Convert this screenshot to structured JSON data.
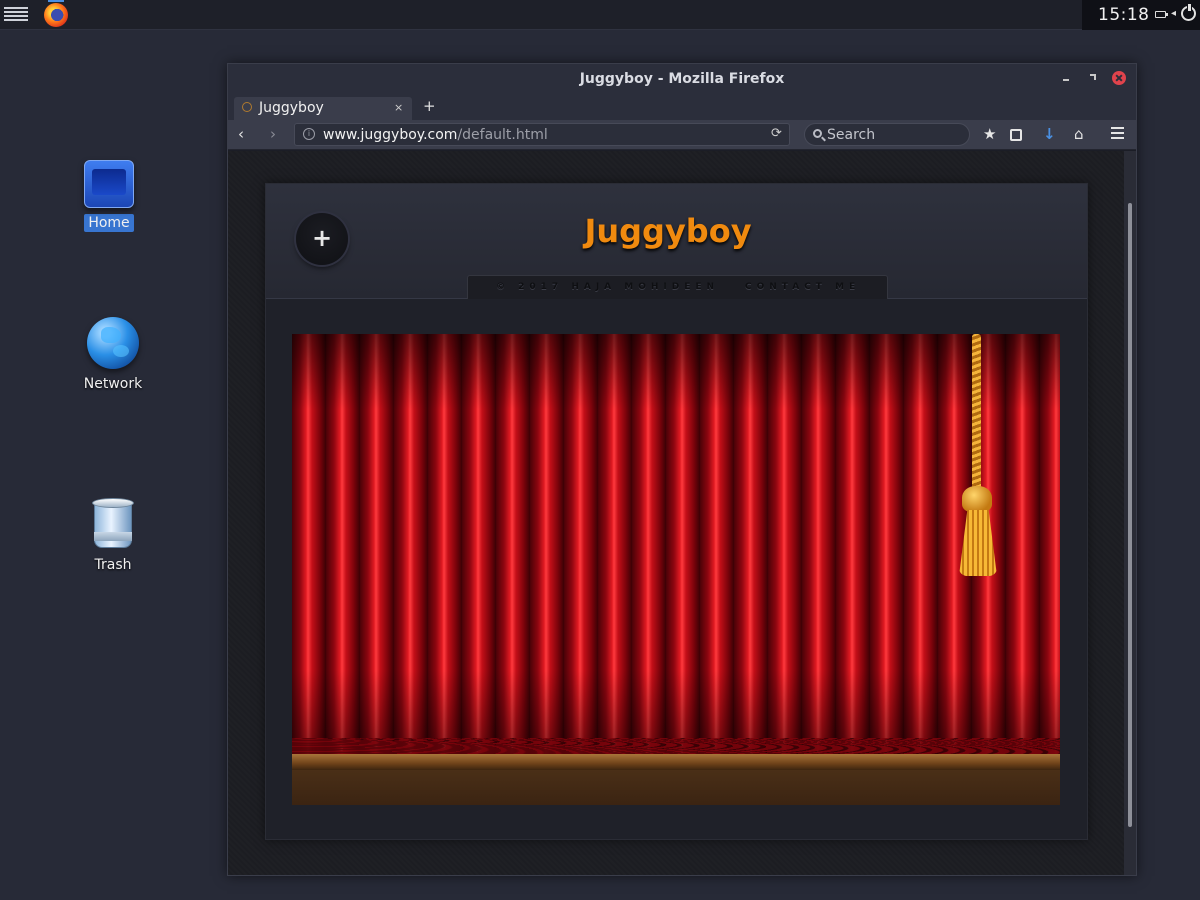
{
  "panel": {
    "clock": "15:18",
    "apps": [
      {
        "name": "Firefox",
        "icon": "firefox-icon"
      }
    ],
    "tray_icons": [
      "battery-icon",
      "volume-icon",
      "power-icon"
    ]
  },
  "desktop": {
    "icons": [
      {
        "label": "Home",
        "icon": "home-folder-icon",
        "selected": true
      },
      {
        "label": "Network",
        "icon": "globe-icon",
        "selected": false
      },
      {
        "label": "Trash",
        "icon": "trash-icon",
        "selected": false
      }
    ]
  },
  "window": {
    "title": "Juggyboy - Mozilla Firefox",
    "tab": {
      "title": "Juggyboy",
      "close": "×"
    },
    "new_tab": "+",
    "nav": {
      "back": "‹",
      "forward": "›",
      "url_domain": "www.juggyboy.com",
      "url_path": "/default.html",
      "reload": "⟳",
      "search_placeholder": "Search",
      "bookmark": "★",
      "download": "↓",
      "home": "⌂"
    }
  },
  "site": {
    "title": "Juggyboy",
    "plus_label": "+",
    "copyright": "© 2017 HAJA MOHIDEEN",
    "contact": "CONTACT ME"
  },
  "colors": {
    "accent": "#f08a0f",
    "selection": "#3875d0",
    "curtain": "#d0141c",
    "close": "#e0434c"
  }
}
